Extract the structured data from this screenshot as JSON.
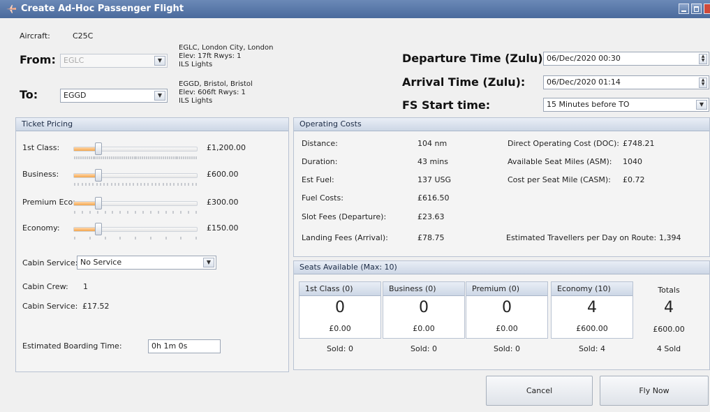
{
  "window": {
    "title": "Create Ad-Hoc Passenger Flight"
  },
  "flight": {
    "aircraft_label": "Aircraft:",
    "aircraft_value": "C25C",
    "from_label": "From:",
    "from_value": "EGLC",
    "from_info": [
      "EGLC, London City, London",
      "Elev: 17ft Rwys: 1",
      "ILS Lights"
    ],
    "to_label": "To:",
    "to_value": "EGGD",
    "to_info": [
      "EGGD, Bristol, Bristol",
      "Elev: 606ft Rwys: 1",
      "ILS Lights"
    ],
    "departure_label": "Departure Time (Zulu):",
    "departure_value": "06/Dec/2020 00:30",
    "arrival_label": "Arrival Time (Zulu):",
    "arrival_value": "06/Dec/2020 01:14",
    "fs_start_label": "FS Start time:",
    "fs_start_value": "15 Minutes before TO"
  },
  "ticket_pricing": {
    "title": "Ticket Pricing",
    "rows": [
      {
        "label": "1st Class:",
        "price": "£1,200.00",
        "level": 0.2
      },
      {
        "label": "Business:",
        "price": "£600.00",
        "level": 0.2
      },
      {
        "label": "Premium Eco:",
        "price": "£300.00",
        "level": 0.2
      },
      {
        "label": "Economy:",
        "price": "£150.00",
        "level": 0.2
      }
    ],
    "cabin_service_label": "Cabin Service:",
    "cabin_service_value": "No Service",
    "cabin_crew_label": "Cabin Crew:",
    "cabin_crew_value": "1",
    "cabin_service_cost_label": "Cabin Service:",
    "cabin_service_cost_value": "£17.52",
    "boarding_label": "Estimated Boarding Time:",
    "boarding_value": "0h 1m 0s"
  },
  "operating_costs": {
    "title": "Operating Costs",
    "left": [
      {
        "label": "Distance:",
        "value": "104 nm"
      },
      {
        "label": "Duration:",
        "value": "43 mins"
      },
      {
        "label": "Est Fuel:",
        "value": "137 USG"
      },
      {
        "label": "Fuel Costs:",
        "value": "£616.50"
      },
      {
        "label": "Slot Fees (Departure):",
        "value": "£23.63"
      },
      {
        "label": "Landing Fees (Arrival):",
        "value": "£78.75"
      }
    ],
    "right": [
      {
        "label": "Direct Operating Cost (DOC):",
        "value": "£748.21"
      },
      {
        "label": "Available Seat Miles (ASM):",
        "value": "1040"
      },
      {
        "label": "Cost per Seat Mile (CASM):",
        "value": "£0.72"
      }
    ],
    "travellers_label": "Estimated Travellers per Day on Route:",
    "travellers_value": "1,394"
  },
  "seats": {
    "title": "Seats Available (Max: 10)",
    "columns": [
      {
        "name": "1st Class (0)",
        "count": "0",
        "amount": "£0.00",
        "sold": "Sold: 0"
      },
      {
        "name": "Business (0)",
        "count": "0",
        "amount": "£0.00",
        "sold": "Sold: 0"
      },
      {
        "name": "Premium (0)",
        "count": "0",
        "amount": "£0.00",
        "sold": "Sold: 0"
      },
      {
        "name": "Economy (10)",
        "count": "4",
        "amount": "£600.00",
        "sold": "Sold: 4"
      }
    ],
    "totals": {
      "label": "Totals",
      "count": "4",
      "amount": "£600.00",
      "sold": "4 Sold"
    }
  },
  "buttons": {
    "cancel": "Cancel",
    "fly_now": "Fly Now"
  },
  "colors": {
    "title_bar": "#4a6a9c",
    "slider_fill": "#f3a64e",
    "close_button": "#d04a3a"
  }
}
